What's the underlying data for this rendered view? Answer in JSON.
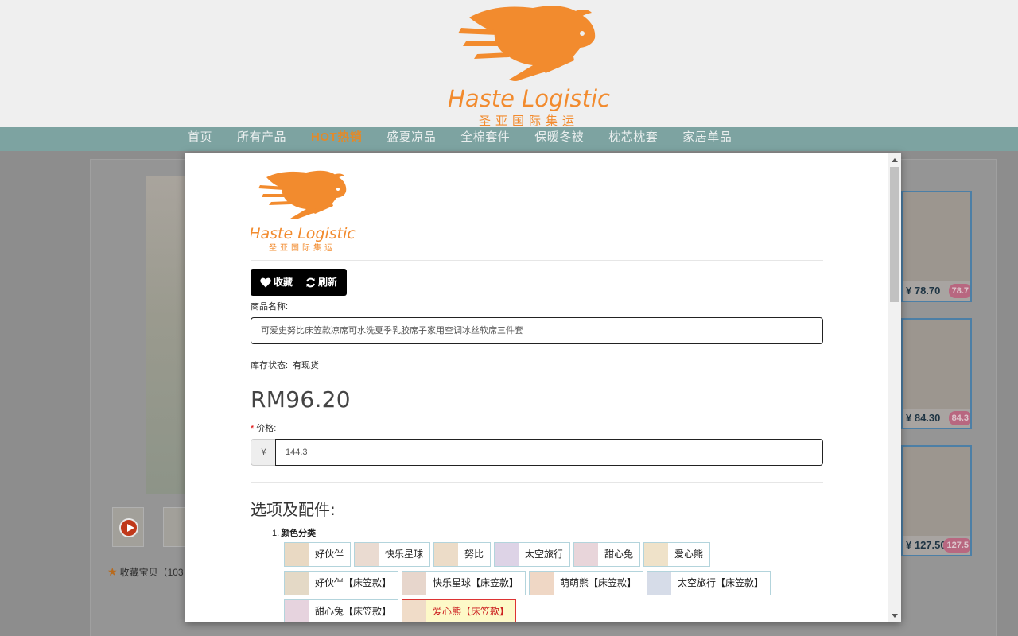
{
  "brand": {
    "name": "Haste Logistic",
    "subtitle": "圣亚国际集运",
    "color": "#f28b2e"
  },
  "nav": {
    "items": [
      "首页",
      "所有产品",
      "HOT热销",
      "盛夏凉品",
      "全棉套件",
      "保暖冬被",
      "枕芯枕套",
      "家居单品"
    ],
    "active_index": 2
  },
  "background": {
    "favorite_text": "收藏宝贝（103",
    "side_prices": [
      {
        "price": "¥ 78.70",
        "tag": "78.7"
      },
      {
        "price": "¥ 84.30",
        "tag": "84.3"
      },
      {
        "price": "¥ 127.50",
        "tag": "127.5"
      }
    ]
  },
  "modal": {
    "buttons": {
      "favorite": "收藏",
      "refresh": "刷新"
    },
    "product_name_label": "商品名称:",
    "product_name": "可爱史努比床笠款凉席可水洗夏季乳胶席子家用空调冰丝软席三件套",
    "stock_label": "库存状态:",
    "stock_value": "有现货",
    "price_display": "RM96.20",
    "price_label": "价格:",
    "price_required_mark": "*",
    "currency_symbol": "¥",
    "price_value": "144.3",
    "options_title": "选项及配件:",
    "option_group": {
      "number": "1.",
      "title": "颜色分类",
      "items": [
        "好伙伴",
        "快乐星球",
        "努比",
        "太空旅行",
        "甜心兔",
        "爱心熊",
        "好伙伴【床笠款】",
        "快乐星球【床笠款】",
        "萌萌熊【床笠款】",
        "太空旅行【床笠款】",
        "甜心兔【床笠款】",
        "爱心熊【床笠款】"
      ],
      "selected_index": 11
    }
  }
}
